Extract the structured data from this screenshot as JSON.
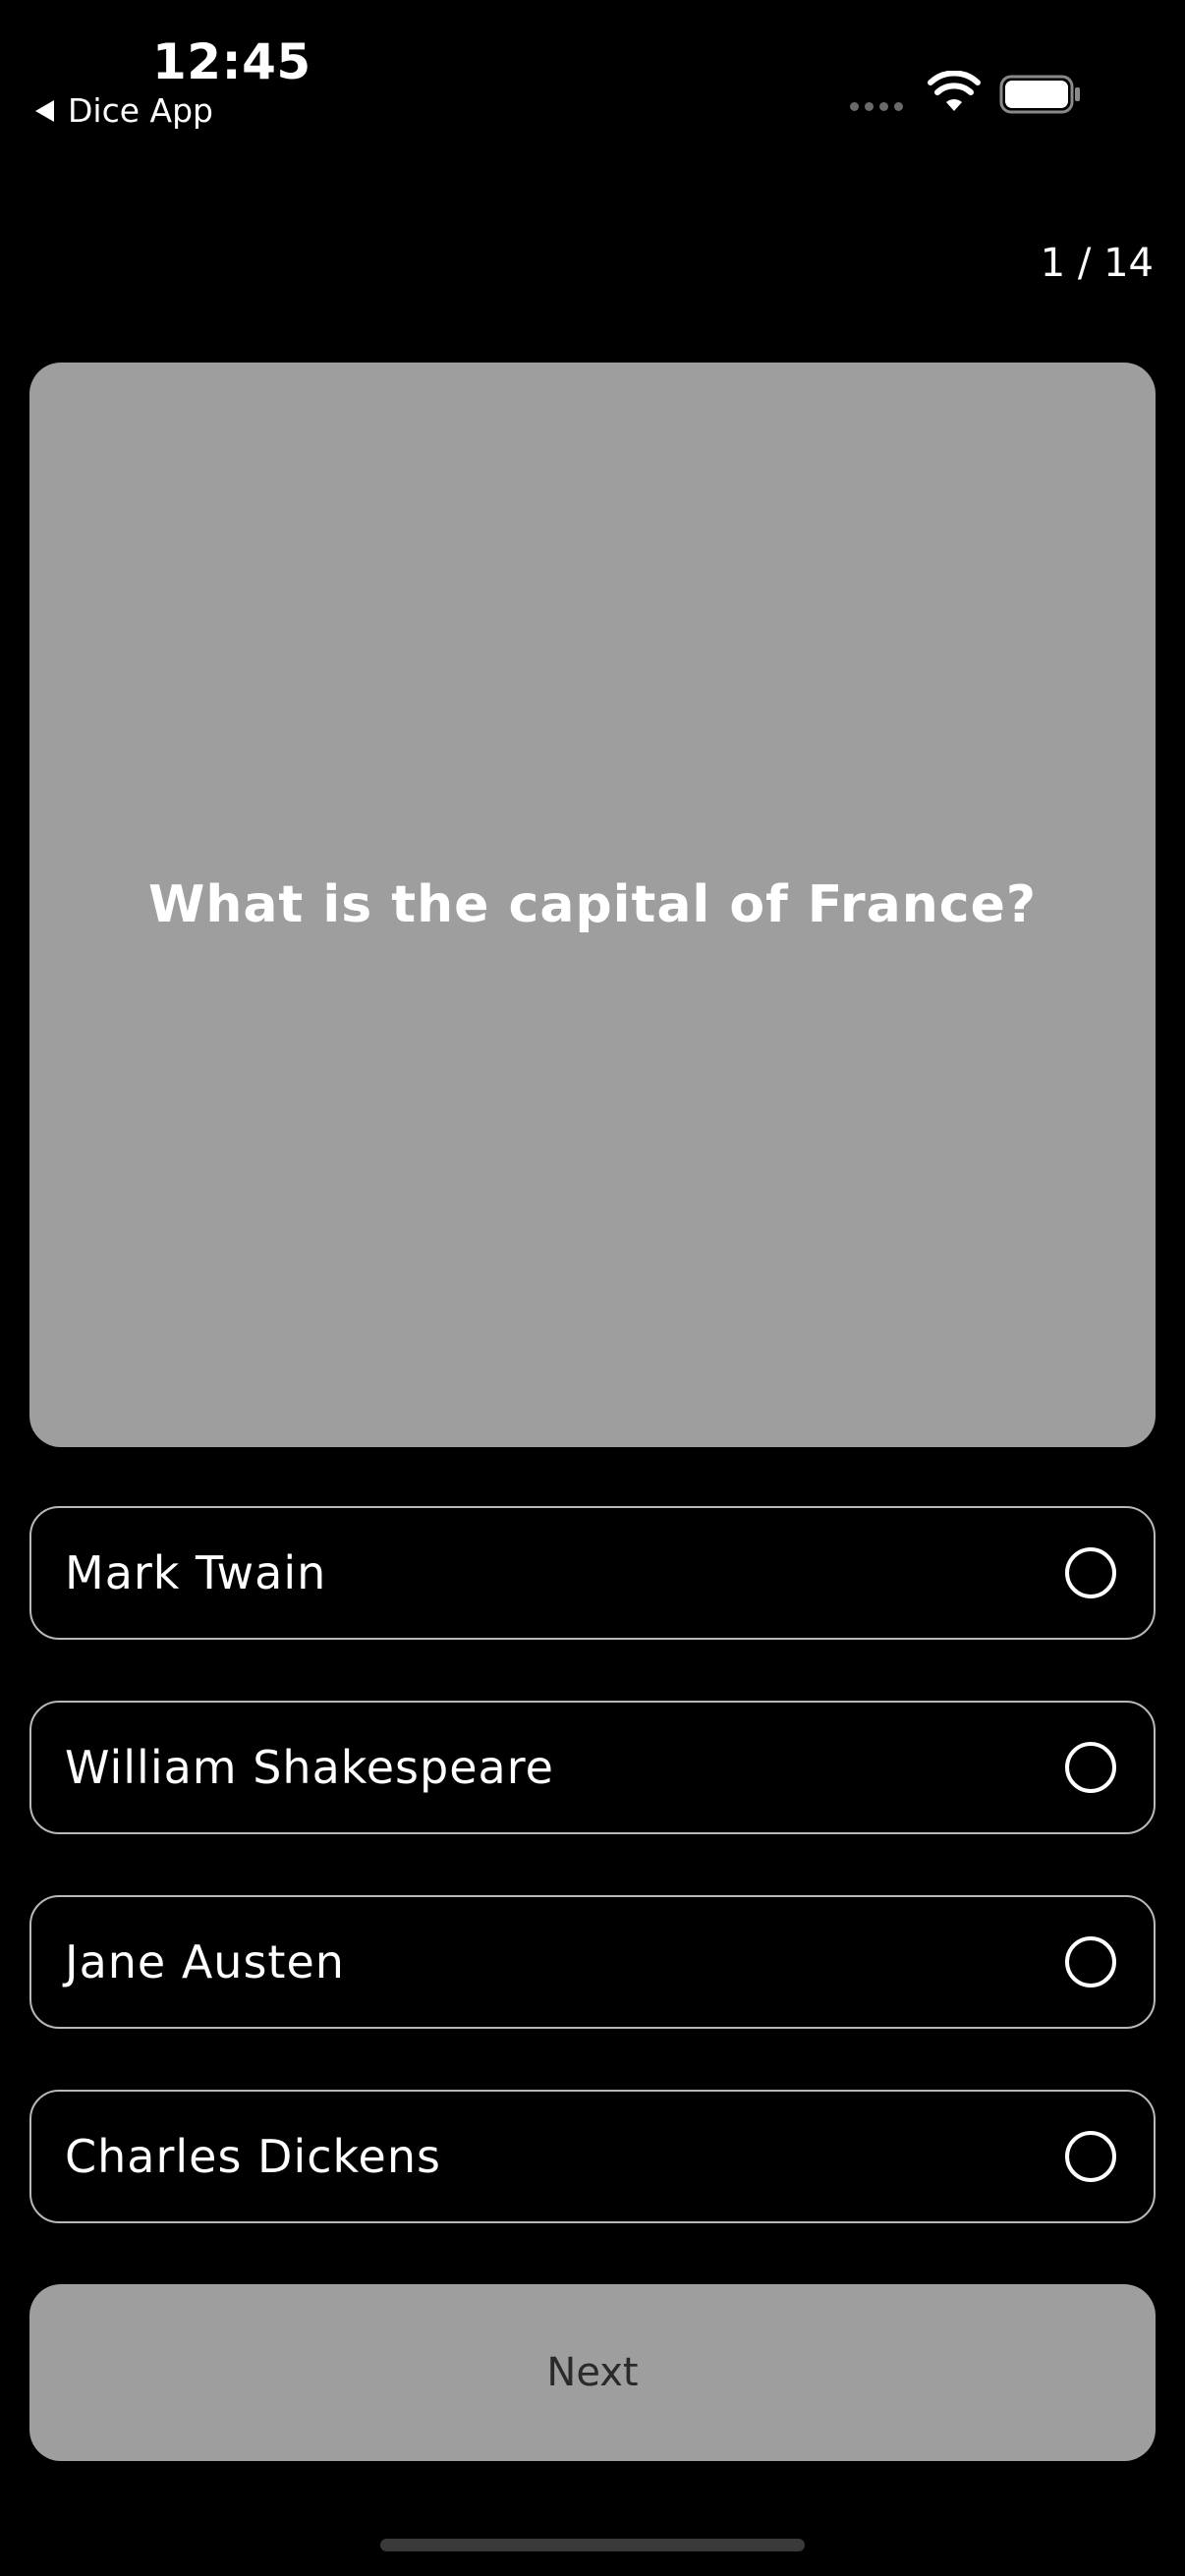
{
  "status_bar": {
    "time": "12:45",
    "back_label": "Dice App"
  },
  "quiz": {
    "progress": "1 / 14",
    "question": "What is the capital of France?",
    "options": [
      "Mark Twain",
      "William Shakespeare",
      "Jane Austen",
      "Charles Dickens"
    ],
    "next_label": "Next"
  },
  "colors": {
    "background": "#000000",
    "card": "#9e9e9e",
    "option_border": "#b8b8b8",
    "text": "#ffffff",
    "next_text": "#2a2a2a"
  }
}
